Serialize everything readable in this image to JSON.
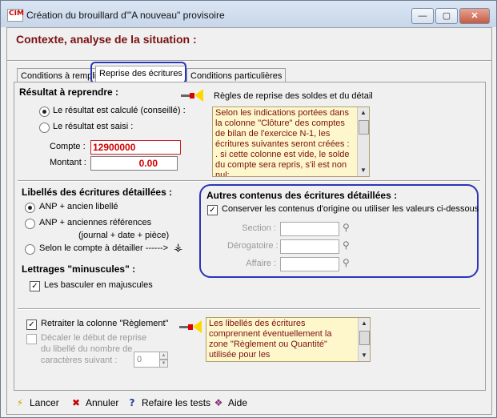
{
  "window": {
    "title": "Création du brouillard d'\"A nouveau\" provisoire",
    "app_icon_text": "CIM",
    "minimize_label": "—",
    "maximize_label": "▢",
    "close_label": "✕"
  },
  "header": {
    "title": "Contexte, analyse de la situation :"
  },
  "tabs": [
    {
      "label": "Conditions à remplir"
    },
    {
      "label": "Reprise des écritures"
    },
    {
      "label": "Conditions particulières"
    }
  ],
  "resultat": {
    "title": "Résultat à reprendre :",
    "option_calc": "Le résultat est calculé (conseillé) :",
    "option_saisi": "Le résultat est saisi :",
    "selected": "calc",
    "compte_label": "Compte :",
    "compte_value": "12900000",
    "montant_label": "Montant :",
    "montant_value": "0.00"
  },
  "regles": {
    "title": "Règles de reprise des soldes et du détail",
    "text": "Selon les indications portées dans la colonne \"Clôture\" des comptes de bilan de l'exercice N-1, les écritures suivantes seront créées :\n. si cette colonne est vide, le solde du compte sera repris, s'il est non nul;"
  },
  "libelles": {
    "title": "Libellés des écritures détaillées :",
    "option1": "ANP + ancien libellé",
    "option2": "ANP + anciennes références",
    "option2_sub": "(journal + date + pièce)",
    "option3": "Selon le compte à détailler ------>",
    "selected": "option1"
  },
  "lettrages": {
    "title": "Lettrages \"minuscules\" :",
    "checkbox_label": "Les basculer en majuscules",
    "checked": true
  },
  "autres": {
    "title": "Autres contenus des écritures détaillées :",
    "checkbox_label": "Conserver les contenus d'origine ou utiliser les valeurs ci-dessous",
    "checked": true,
    "section_label": "Section :",
    "derogatoire_label": "Dérogatoire :",
    "affaire_label": "Affaire :"
  },
  "reglement": {
    "checkbox_label": "Retraiter la colonne \"Règlement\"",
    "checked": true,
    "decaler_label_1": "Décaler le début de reprise",
    "decaler_label_2": "du libellé du nombre de",
    "decaler_label_3": "caractères suivant :",
    "decaler_checked": false,
    "decaler_value": "0",
    "info_text": "Les libellés des écritures comprennent éventuellement la zone \"Règlement ou Quantité\" utilisée pour les"
  },
  "buttons": {
    "lancer": "Lancer",
    "annuler": "Annuler",
    "refaire": "Refaire les tests",
    "aide": "Aide"
  }
}
